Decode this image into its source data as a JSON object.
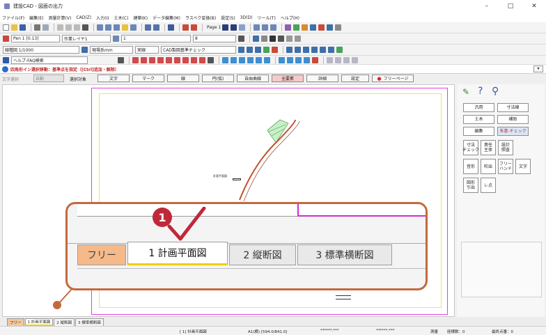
{
  "window": {
    "title": "建設CAD - 図面の出力",
    "min": "–",
    "max": "□",
    "close": "✕"
  },
  "menu": [
    "ファイル(F)",
    "編集(E)",
    "測量計算(V)",
    "CAD(Z)",
    "入力(I)",
    "土木(C)",
    "建築(K)",
    "データ編集(M)",
    "ラスベク変換(B)",
    "設定(S)",
    "3D(D)",
    "ツール(T)",
    "ヘルプ(H)"
  ],
  "toolbar1": {
    "page_label": "Page 1"
  },
  "toolbar2": {
    "pen": "Pen 1 [0.13]",
    "layer": "作業レイヤ1",
    "line_no": "1",
    "scale_no": "8"
  },
  "toolbar3": {
    "line_type": "線種図 1/1000",
    "unit": "現場系mm",
    "style": "実線",
    "check": "CAD製図基準チェック"
  },
  "toolbar4": {
    "help": "ヘルプ-FAQ検索"
  },
  "info": {
    "text": "四角形イン選択移動：基準点を指定（[Ctrl]追加・解除）"
  },
  "selbar": {
    "label": "文字選択",
    "mode": "自動",
    "target": "選択対象",
    "dropdown": "▾"
  },
  "modes": {
    "text": "文字",
    "mark": "マーク",
    "line": "線",
    "arc": "円(弧)",
    "free_curve": "自由曲線",
    "all": "全要素",
    "detail": "詳細",
    "settings": "設定",
    "free_page": "フリーページ"
  },
  "panel": {
    "general": "汎用",
    "dim_line": "寸法線",
    "civil": "土木",
    "aux": "補助",
    "edit": "編集",
    "red_check": "朱書-チェック",
    "dim_check": "寸法\nチェック",
    "resp_main": "責任\n主体",
    "design_ctrl": "設計\n照査",
    "stamp": "音形",
    "balloon": "吹出",
    "freehand": "フリー\nハンド",
    "text_btn": "文字",
    "shape_pull": "図形\n引出",
    "point": "レ点"
  },
  "drawing": {
    "plan_label": "計画平面図"
  },
  "callout": {
    "badge": "1",
    "tab_free": "フリー",
    "tab1": "1 計画平面図",
    "tab2": "2 縦断図",
    "tab3": "3 標準横断図"
  },
  "tabs": [
    "フリー",
    "1 計画平面図",
    "2 縦断図",
    "3 標準横断図"
  ],
  "status": {
    "sheet": "[ 1] 計画平面図",
    "paper": "A1(横) [594.0/841.0]",
    "coord1": "******.***",
    "coord2": "******.***",
    "survey": "測量",
    "count": "座標数：0",
    "last": "最終点番：0"
  }
}
